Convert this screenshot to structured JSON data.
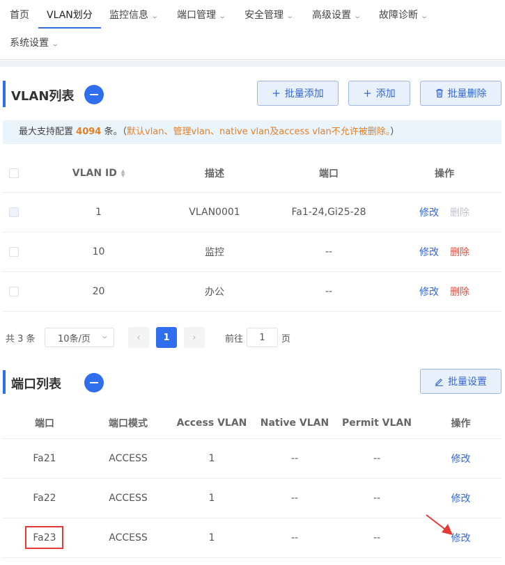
{
  "nav": {
    "items": [
      "首页",
      "VLAN划分",
      "监控信息",
      "端口管理",
      "安全管理",
      "高级设置",
      "故障诊断",
      "系统设置"
    ]
  },
  "vlan_section": {
    "title": "VLAN列表",
    "batch_add": "批量添加",
    "add": "添加",
    "batch_delete": "批量删除",
    "info": {
      "prefix": "最大支持配置",
      "count": "4094",
      "suffix": "条。（",
      "warning": "默认vlan、管理vlan、native vlan及access vlan不允许被删除。",
      "close": "）"
    },
    "columns": [
      "VLAN ID",
      "描述",
      "端口",
      "操作"
    ],
    "rows": [
      {
        "id": "1",
        "desc": "VLAN0001",
        "ports": "Fa1-24,Gi25-28",
        "edit": "修改",
        "delete": "删除",
        "delete_enabled": false
      },
      {
        "id": "10",
        "desc": "监控",
        "ports": "--",
        "edit": "修改",
        "delete": "删除",
        "delete_enabled": true
      },
      {
        "id": "20",
        "desc": "办公",
        "ports": "--",
        "edit": "修改",
        "delete": "删除",
        "delete_enabled": true
      }
    ],
    "pagination": {
      "total": "共 3 条",
      "page_size": "10条/页",
      "current_page": "1",
      "prev": "‹",
      "next": "›",
      "goto_label": "前往",
      "goto_value": "1",
      "page_label": "页"
    }
  },
  "port_section": {
    "title": "端口列表",
    "batch_set": "批量设置",
    "columns": [
      "端口",
      "端口模式",
      "Access VLAN",
      "Native VLAN",
      "Permit VLAN",
      "操作"
    ],
    "rows": [
      {
        "port": "Fa21",
        "mode": "ACCESS",
        "access": "1",
        "native": "--",
        "permit": "--",
        "edit": "修改"
      },
      {
        "port": "Fa22",
        "mode": "ACCESS",
        "access": "1",
        "native": "--",
        "permit": "--",
        "edit": "修改"
      },
      {
        "port": "Fa23",
        "mode": "ACCESS",
        "access": "1",
        "native": "--",
        "permit": "--",
        "edit": "修改"
      }
    ]
  },
  "colors": {
    "accent": "#2f6fed",
    "warning": "#e67e22",
    "danger": "#e74c3c",
    "highlight": "#e53935"
  }
}
